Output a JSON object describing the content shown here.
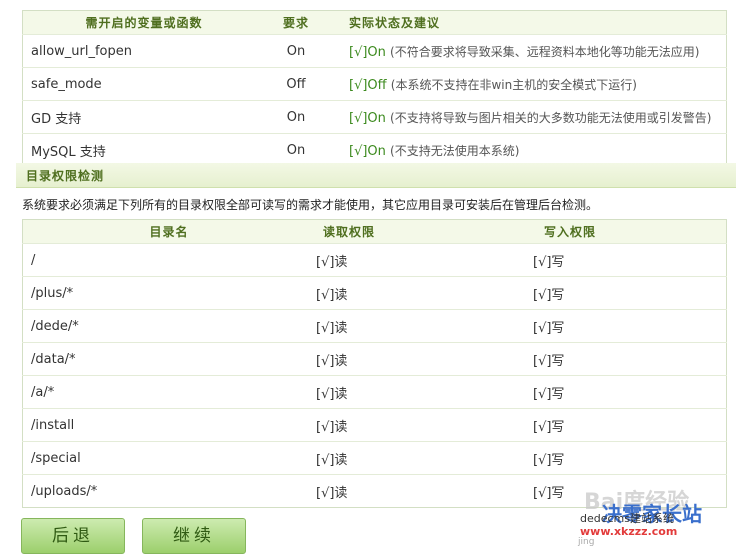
{
  "func_table": {
    "headers": [
      "需开启的变量或函数",
      "要求",
      "实际状态及建议"
    ],
    "rows": [
      {
        "name": "allow_url_fopen",
        "req": "On",
        "status": "[√]On",
        "note": "(不符合要求将导致采集、远程资料本地化等功能无法应用)"
      },
      {
        "name": "safe_mode",
        "req": "Off",
        "status": "[√]Off",
        "note": "(本系统不支持在非win主机的安全模式下运行)"
      },
      {
        "name": "GD 支持",
        "req": "On",
        "status": "[√]On",
        "note": "(不支持将导致与图片相关的大多数功能无法使用或引发警告)"
      },
      {
        "name": "MySQL 支持",
        "req": "On",
        "status": "[√]On",
        "note": "(不支持无法使用本系统)"
      }
    ]
  },
  "section_title": "目录权限检测",
  "description": "系统要求必须满足下列所有的目录权限全部可读写的需求才能使用，其它应用目录可安装后在管理后台检测。",
  "dir_table": {
    "headers": [
      "目录名",
      "读取权限",
      "写入权限"
    ],
    "rows": [
      {
        "dir": "/",
        "read": "[√]读",
        "write": "[√]写"
      },
      {
        "dir": "/plus/*",
        "read": "[√]读",
        "write": "[√]写"
      },
      {
        "dir": "/dede/*",
        "read": "[√]读",
        "write": "[√]写"
      },
      {
        "dir": "/data/*",
        "read": "[√]读",
        "write": "[√]写"
      },
      {
        "dir": "/a/*",
        "read": "[√]读",
        "write": "[√]写"
      },
      {
        "dir": "/install",
        "read": "[√]读",
        "write": "[√]写"
      },
      {
        "dir": "/special",
        "read": "[√]读",
        "write": "[√]写"
      },
      {
        "dir": "/uploads/*",
        "read": "[√]读",
        "write": "[√]写"
      }
    ]
  },
  "buttons": {
    "back": "后退",
    "next": "继续"
  },
  "watermark": {
    "baidu": "Bai度经验",
    "site_cn": "决零家长站",
    "cms": "dedecms建站系统",
    "url": "www.xkzzz.com",
    "jing": "jing"
  },
  "colors": {
    "accent": "#4f6f1f",
    "ok": "#3c8a1e",
    "border": "#d3dfc4"
  }
}
